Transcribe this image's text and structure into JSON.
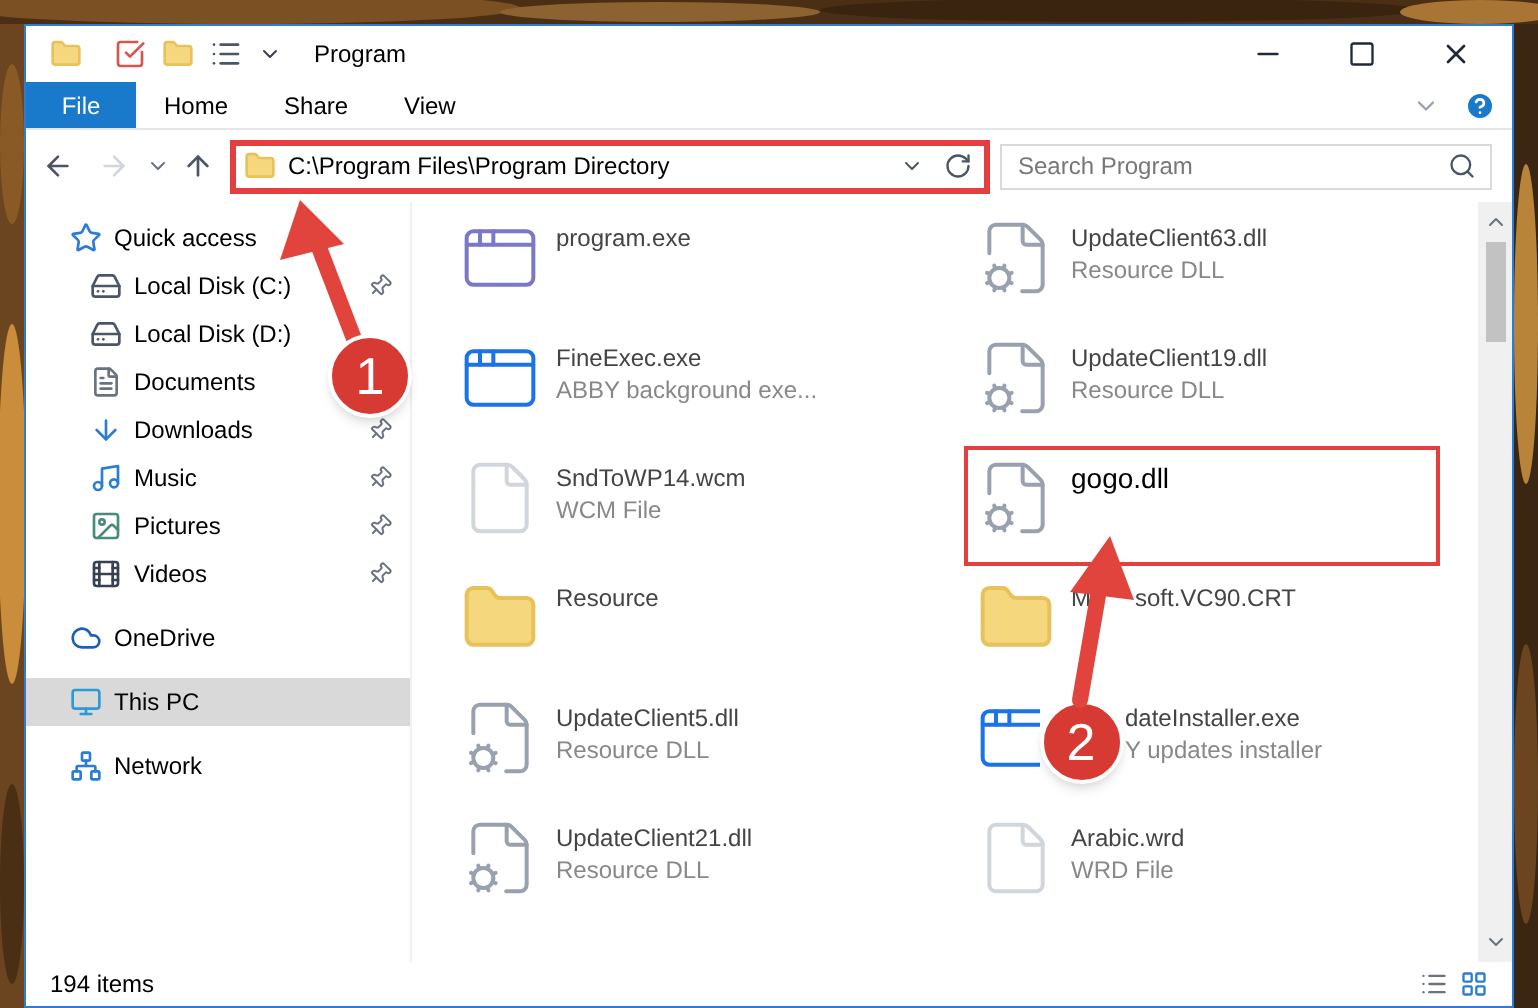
{
  "window": {
    "title": "Program"
  },
  "ribbon_tabs": [
    {
      "label": "File",
      "kind": "file"
    },
    {
      "label": "Home",
      "kind": "tab"
    },
    {
      "label": "Share",
      "kind": "tab"
    },
    {
      "label": "View",
      "kind": "tab"
    }
  ],
  "address": {
    "path": "C:\\Program Files\\Program Directory",
    "highlighted": true
  },
  "search": {
    "placeholder": "Search Program"
  },
  "nav": [
    {
      "label": "Quick access",
      "selected": false,
      "children": [
        {
          "label": "Local Disk (C:)",
          "pinned": true
        },
        {
          "label": "Local Disk (D:)"
        },
        {
          "label": "Documents"
        },
        {
          "label": "Downloads",
          "pinned": true
        },
        {
          "label": "Music",
          "pinned": true
        },
        {
          "label": "Pictures",
          "pinned": true
        },
        {
          "label": "Videos",
          "pinned": true
        }
      ]
    },
    {
      "label": "OneDrive",
      "selected": false
    },
    {
      "label": "This PC",
      "selected": true
    },
    {
      "label": "Network",
      "selected": false
    }
  ],
  "files": [
    {
      "name_parts": [
        "program.exe"
      ],
      "kind": "app",
      "highlighted": false
    },
    {
      "name_parts": [
        "UpdateClient63.dll"
      ],
      "type": "Resource DLL",
      "kind": "dll",
      "highlighted": false
    },
    {
      "name_parts": [
        "FineExec.exe"
      ],
      "type": "ABBY background exe...",
      "kind": "window",
      "highlighted": false
    },
    {
      "name_parts": [
        "UpdateClient19.dll"
      ],
      "type": "Resource DLL",
      "kind": "dll",
      "highlighted": false
    },
    {
      "name_parts": [
        "SndToWP14.wcm"
      ],
      "type": "WCM File",
      "kind": "blank",
      "highlighted": false
    },
    {
      "name_parts": [
        "gogo.dll"
      ],
      "kind": "dll",
      "highlighted": true
    },
    {
      "name_parts": [
        "Resource"
      ],
      "kind": "folder",
      "highlighted": false
    },
    {
      "name_parts": [
        "M",
        "soft.VC90.CRT"
      ],
      "kind": "folder",
      "highlighted": false
    },
    {
      "name_parts": [
        "UpdateClient5.dll"
      ],
      "type": "Resource DLL",
      "kind": "dll",
      "highlighted": false
    },
    {
      "name_parts": [
        "dateInstaller.exe"
      ],
      "type": "Y updates installer",
      "kind": "window",
      "highlighted": false,
      "callout": "2"
    },
    {
      "name_parts": [
        "UpdateClient21.dll"
      ],
      "type": "Resource DLL",
      "kind": "dll",
      "highlighted": false
    },
    {
      "name_parts": [
        "Arabic.wrd"
      ],
      "type": "WRD File",
      "kind": "blank",
      "highlighted": false
    }
  ],
  "status_bar": {
    "count": "194 items"
  },
  "callouts": [
    {
      "number": "1"
    }
  ]
}
